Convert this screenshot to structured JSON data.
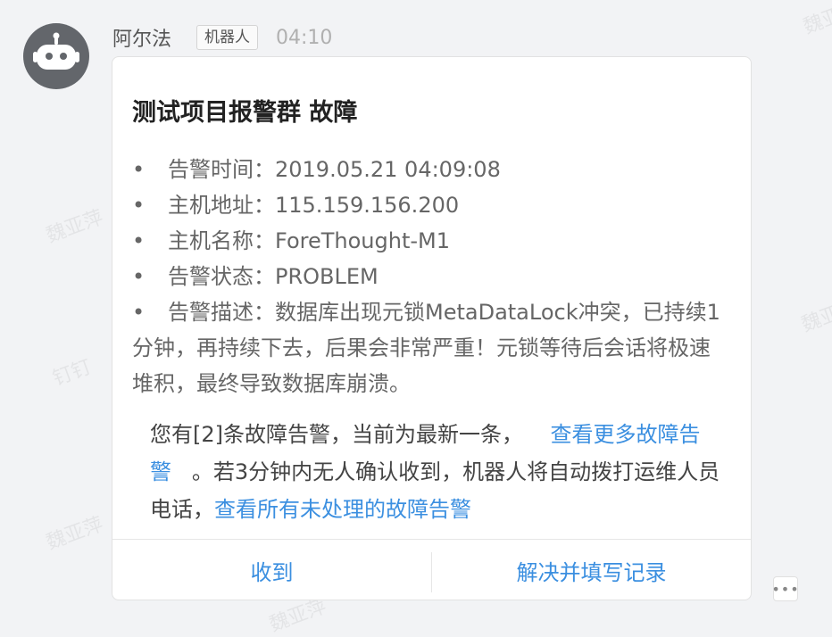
{
  "sender": {
    "name": "阿尔法",
    "badge": "机器人",
    "time": "04:10"
  },
  "card": {
    "title": "测试项目报警群 故障",
    "items": [
      {
        "label": "告警时间：",
        "value": "2019.05.21 04:09:08"
      },
      {
        "label": "主机地址：",
        "value": "115.159.156.200"
      },
      {
        "label": "主机名称：",
        "value": "ForeThought-M1"
      },
      {
        "label": "告警状态：",
        "value": "PROBLEM"
      },
      {
        "label": "告警描述：",
        "value": "数据库出现元锁MetaDataLock冲突，已持续1分钟，再持续下去，后果会非常严重！元锁等待后会话将极速堆积，最终导致数据库崩溃。"
      }
    ],
    "footer": {
      "text1": "您有[2]条故障告警，当前为最新一条，",
      "link1": "查看更多故障告警",
      "text2": "。若3分钟内无人确认收到，机器人将自动拨打运维人员电话，",
      "link2": "查看所有未处理的故障告警"
    },
    "buttons": {
      "receive": "收到",
      "resolve": "解决并填写记录"
    }
  },
  "watermark": {
    "name": "魏亚萍",
    "app": "钉钉"
  },
  "icons": {
    "avatar": "robot-icon",
    "more": "more-dots-icon"
  },
  "colors": {
    "link": "#3b8fe0",
    "avatar_bg": "#63666b"
  }
}
